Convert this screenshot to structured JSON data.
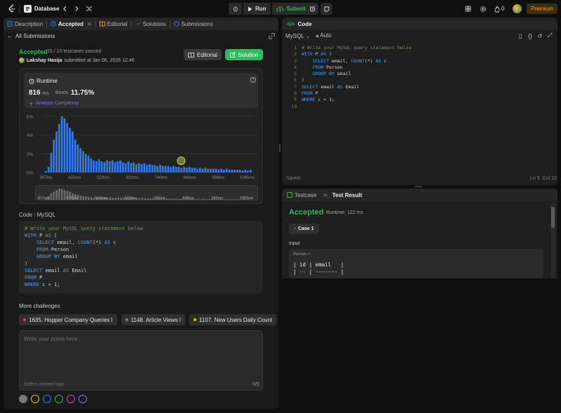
{
  "topbar": {
    "title": "Database",
    "run_label": "Run",
    "submit_label": "Submit",
    "streak": "0",
    "premium_label": "Premium"
  },
  "left_tabs": [
    {
      "label": "Description",
      "icon": "description-icon"
    },
    {
      "label": "Accepted",
      "icon": "accepted-icon",
      "active": true
    },
    {
      "label": "Editorial",
      "icon": "editorial-icon"
    },
    {
      "label": "Solutions",
      "icon": "solutions-icon"
    },
    {
      "label": "Submissions",
      "icon": "submissions-icon"
    }
  ],
  "submission": {
    "back_label": "All Submissions",
    "status": "Accepted",
    "testcases": "15 / 15 testcases passed",
    "user": "Lakshay Hasija",
    "submitted": "submitted at Jan 06, 2025 12:46",
    "editorial_btn": "Editorial",
    "solution_btn": "Solution"
  },
  "runtime": {
    "label": "Runtime",
    "value": "816",
    "unit": "ms",
    "beats_label": "Beats",
    "beats_value": "11.75%",
    "analyze_label": "Analyze Complexity"
  },
  "chart_data": {
    "type": "bar",
    "yticks": [
      "6%",
      "4%",
      "2%",
      "0%"
    ],
    "ylim": [
      0,
      6
    ],
    "xticks": [
      "307ms",
      "415ms",
      "523ms",
      "632ms",
      "740ms",
      "848ms",
      "956ms",
      "1065ms"
    ],
    "xlim": [
      290,
      1100
    ],
    "x_start": 307,
    "x_step": 10,
    "values": [
      0.15,
      0.6,
      2.1,
      3.5,
      4.4,
      5.2,
      6.0,
      5.8,
      5.3,
      4.8,
      4.4,
      3.5,
      3.0,
      2.6,
      2.3,
      2.0,
      1.8,
      1.5,
      1.3,
      1.2,
      1.4,
      1.2,
      1.1,
      1.3,
      1.2,
      1.3,
      1.1,
      1.2,
      1.3,
      1.1,
      1.0,
      1.2,
      1.0,
      1.1,
      0.9,
      1.0,
      0.9,
      1.0,
      0.8,
      0.9,
      0.8,
      0.8,
      0.7,
      0.8,
      0.7,
      0.7,
      0.7,
      0.6,
      0.7,
      0.6,
      0.6,
      0.5,
      0.6,
      0.5,
      0.6,
      0.5,
      0.5,
      0.4,
      0.5,
      0.4,
      0.5,
      0.4,
      0.4,
      0.4,
      0.4,
      0.3,
      0.4,
      0.3,
      0.4,
      0.3,
      0.3,
      0.3,
      0.3,
      0.3,
      0.2,
      0.3,
      0.2,
      0.3
    ],
    "user_marker_ms": 816,
    "user_marker_pct": 0.8
  },
  "left_code": {
    "header": "Code",
    "lang": "MySQL",
    "lines": [
      [
        {
          "c": "c",
          "t": "# Write your MySQL query statement below"
        }
      ],
      [
        {
          "c": "k",
          "t": "WITH"
        },
        {
          "c": "t",
          "t": " P "
        },
        {
          "c": "k",
          "t": "AS"
        },
        {
          "c": "t",
          "t": " ("
        }
      ],
      [
        {
          "c": "t",
          "t": "    "
        },
        {
          "c": "k",
          "t": "SELECT"
        },
        {
          "c": "t",
          "t": " email, "
        },
        {
          "c": "k",
          "t": "COUNT"
        },
        {
          "c": "t",
          "t": "(*) "
        },
        {
          "c": "k",
          "t": "AS"
        },
        {
          "c": "t",
          "t": " c"
        }
      ],
      [
        {
          "c": "t",
          "t": "    "
        },
        {
          "c": "k",
          "t": "FROM"
        },
        {
          "c": "t",
          "t": " Person"
        }
      ],
      [
        {
          "c": "t",
          "t": "    "
        },
        {
          "c": "k",
          "t": "GROUP BY"
        },
        {
          "c": "t",
          "t": " email"
        }
      ],
      [
        {
          "c": "t",
          "t": ")"
        }
      ],
      [
        {
          "c": "k",
          "t": "SELECT"
        },
        {
          "c": "t",
          "t": " email "
        },
        {
          "c": "k",
          "t": "AS"
        },
        {
          "c": "t",
          "t": " Email"
        }
      ],
      [
        {
          "c": "k",
          "t": "FROM"
        },
        {
          "c": "t",
          "t": " P"
        }
      ],
      [
        {
          "c": "k",
          "t": "WHERE"
        },
        {
          "c": "t",
          "t": " c > 1;"
        }
      ]
    ]
  },
  "more": {
    "header": "More challenges",
    "chips": [
      {
        "label": "1635. Hopper Company Queries I",
        "color": "#f63636"
      },
      {
        "label": "1148. Article Views I",
        "color": "#2cbb5d"
      },
      {
        "label": "1107. New Users Daily Count",
        "color": "#ffb800"
      }
    ]
  },
  "notes": {
    "placeholder": "Write your notes here",
    "tags": "Select related tags",
    "count": "0/5"
  },
  "note_colors": [
    "#7a7a7a",
    "#ffb800",
    "#2f7df6",
    "#2cbb5d",
    "#cf4ad9",
    "#8b6ff0"
  ],
  "editor": {
    "title": "Code",
    "lang": "MySQL",
    "auto": "Auto",
    "saved": "Saved",
    "position": "Ln 9, Col 13",
    "line_numbers": [
      "1",
      "2",
      "3",
      "4",
      "5",
      "6",
      "7",
      "8",
      "9",
      "10"
    ],
    "lines": [
      [
        {
          "c": "c",
          "t": "# Write your MySQL query statement below"
        }
      ],
      [
        {
          "c": "k",
          "t": "WITH"
        },
        {
          "c": "t",
          "t": " P "
        },
        {
          "c": "k",
          "t": "AS"
        },
        {
          "c": "t",
          "t": " ("
        }
      ],
      [
        {
          "c": "t",
          "t": "    "
        },
        {
          "c": "k",
          "t": "SELECT"
        },
        {
          "c": "t",
          "t": " email, "
        },
        {
          "c": "k",
          "t": "COUNT"
        },
        {
          "c": "t",
          "t": "(*) "
        },
        {
          "c": "k",
          "t": "AS"
        },
        {
          "c": "t",
          "t": " c"
        }
      ],
      [
        {
          "c": "t",
          "t": "    "
        },
        {
          "c": "k",
          "t": "FROM"
        },
        {
          "c": "t",
          "t": " Person"
        }
      ],
      [
        {
          "c": "t",
          "t": "    "
        },
        {
          "c": "k",
          "t": "GROUP BY"
        },
        {
          "c": "t",
          "t": " email"
        }
      ],
      [
        {
          "c": "t",
          "t": ")"
        }
      ],
      [
        {
          "c": "k",
          "t": "SELECT"
        },
        {
          "c": "t",
          "t": " email "
        },
        {
          "c": "k",
          "t": "AS"
        },
        {
          "c": "t",
          "t": " Email"
        }
      ],
      [
        {
          "c": "k",
          "t": "FROM"
        },
        {
          "c": "t",
          "t": " P"
        }
      ],
      [
        {
          "c": "k",
          "t": "WHERE"
        },
        {
          "c": "t",
          "t": " c > 1;"
        }
      ],
      [
        {
          "c": "t",
          "t": ""
        }
      ]
    ]
  },
  "test": {
    "tab_testcase": "Testcase",
    "tab_result": "Test Result",
    "status": "Accepted",
    "runtime": "Runtime: 122 ms",
    "case_label": "Case 1",
    "input_label": "Input",
    "table_name": "Person =",
    "table_lines": [
      "| id | email   |",
      "| -- | ------- |"
    ]
  }
}
